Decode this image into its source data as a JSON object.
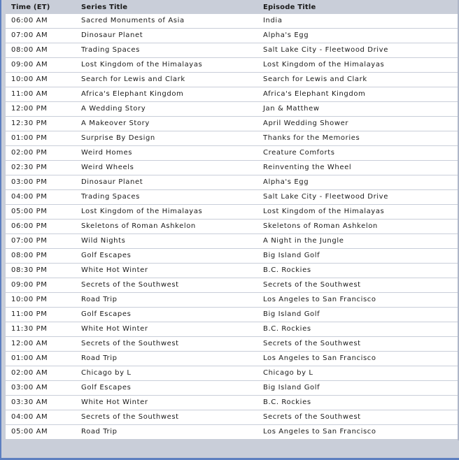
{
  "columns": {
    "time": "Time (ET)",
    "series": "Series Title",
    "episode": "Episode Title"
  },
  "rows": [
    {
      "time": "06:00 AM",
      "series": "Sacred Monuments of Asia",
      "episode": "India"
    },
    {
      "time": "07:00 AM",
      "series": "Dinosaur Planet",
      "episode": "Alpha's Egg"
    },
    {
      "time": "08:00 AM",
      "series": "Trading Spaces",
      "episode": "Salt Lake City - Fleetwood Drive"
    },
    {
      "time": "09:00 AM",
      "series": "Lost Kingdom of the Himalayas",
      "episode": "Lost Kingdom of the Himalayas"
    },
    {
      "time": "10:00 AM",
      "series": "Search for Lewis and Clark",
      "episode": "Search for Lewis and Clark"
    },
    {
      "time": "11:00 AM",
      "series": "Africa's Elephant Kingdom",
      "episode": "Africa's Elephant Kingdom"
    },
    {
      "time": "12:00 PM",
      "series": "A Wedding Story",
      "episode": "Jan & Matthew"
    },
    {
      "time": "12:30 PM",
      "series": "A Makeover Story",
      "episode": "April Wedding Shower"
    },
    {
      "time": "01:00 PM",
      "series": "Surprise By Design",
      "episode": "Thanks for the Memories"
    },
    {
      "time": "02:00 PM",
      "series": "Weird Homes",
      "episode": "Creature Comforts"
    },
    {
      "time": "02:30 PM",
      "series": "Weird Wheels",
      "episode": "Reinventing the Wheel"
    },
    {
      "time": "03:00 PM",
      "series": "Dinosaur Planet",
      "episode": "Alpha's Egg"
    },
    {
      "time": "04:00 PM",
      "series": "Trading Spaces",
      "episode": "Salt Lake City - Fleetwood Drive"
    },
    {
      "time": "05:00 PM",
      "series": "Lost Kingdom of the Himalayas",
      "episode": "Lost Kingdom of the Himalayas"
    },
    {
      "time": "06:00 PM",
      "series": "Skeletons of Roman Ashkelon",
      "episode": "Skeletons of Roman Ashkelon"
    },
    {
      "time": "07:00 PM",
      "series": "Wild Nights",
      "episode": "A Night in the Jungle"
    },
    {
      "time": "08:00 PM",
      "series": "Golf Escapes",
      "episode": "Big Island Golf"
    },
    {
      "time": "08:30 PM",
      "series": "White Hot Winter",
      "episode": "B.C. Rockies"
    },
    {
      "time": "09:00 PM",
      "series": "Secrets of the Southwest",
      "episode": "Secrets of the Southwest"
    },
    {
      "time": "10:00 PM",
      "series": "Road Trip",
      "episode": "Los Angeles to San Francisco"
    },
    {
      "time": "11:00 PM",
      "series": "Golf Escapes",
      "episode": "Big Island Golf"
    },
    {
      "time": "11:30 PM",
      "series": "White Hot Winter",
      "episode": "B.C. Rockies"
    },
    {
      "time": "12:00 AM",
      "series": "Secrets of the Southwest",
      "episode": "Secrets of the Southwest"
    },
    {
      "time": "01:00 AM",
      "series": "Road Trip",
      "episode": "Los Angeles to San Francisco"
    },
    {
      "time": "02:00 AM",
      "series": "Chicago by L",
      "episode": "Chicago by L"
    },
    {
      "time": "03:00 AM",
      "series": "Golf Escapes",
      "episode": "Big Island Golf"
    },
    {
      "time": "03:30 AM",
      "series": "White Hot Winter",
      "episode": "B.C. Rockies"
    },
    {
      "time": "04:00 AM",
      "series": "Secrets of the Southwest",
      "episode": "Secrets of the Southwest"
    },
    {
      "time": "05:00 AM",
      "series": "Road Trip",
      "episode": "Los Angeles to San Francisco"
    }
  ],
  "colors": {
    "header_bg": "#c9ced9",
    "row_bg": "#ffffff",
    "row_divider": "#c9ced9",
    "frame_accent": "#5d7fc0"
  }
}
